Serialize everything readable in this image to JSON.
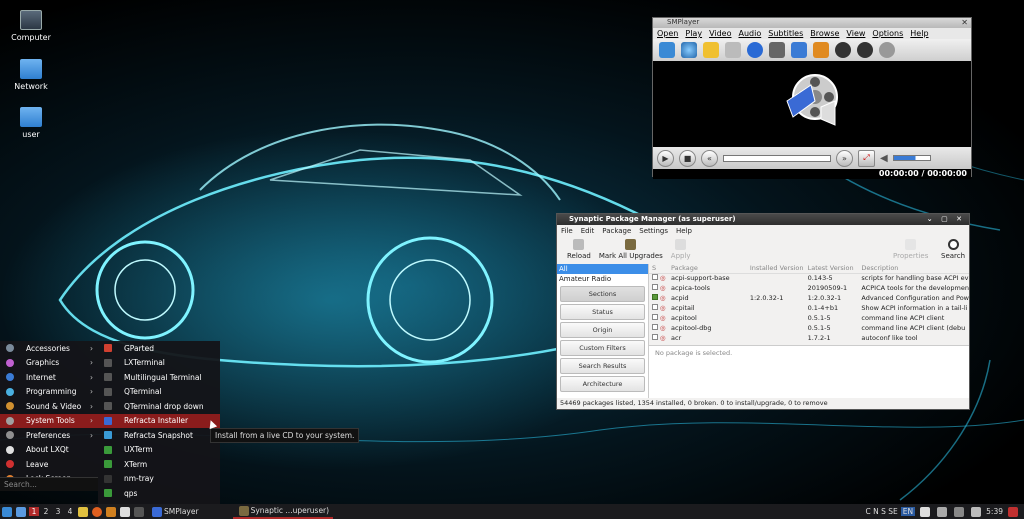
{
  "desktop_icons": [
    {
      "label": "Computer",
      "icon": "computer-icon"
    },
    {
      "label": "Network",
      "icon": "network-folder-icon"
    },
    {
      "label": "user",
      "icon": "home-folder-icon"
    }
  ],
  "smplayer": {
    "title": "SMPlayer",
    "menu": [
      "Open",
      "Play",
      "Video",
      "Audio",
      "Subtitles",
      "Browse",
      "View",
      "Options",
      "Help"
    ],
    "time": "00:00:00 / 00:00:00"
  },
  "synaptic": {
    "title": "Synaptic Package Manager  (as superuser)",
    "menu": [
      "File",
      "Edit",
      "Package",
      "Settings",
      "Help"
    ],
    "toolbar": {
      "reload": "Reload",
      "mark_all": "Mark All Upgrades",
      "apply": "Apply",
      "properties": "Properties",
      "search": "Search"
    },
    "filters": [
      "All",
      "Amateur Radio"
    ],
    "side_buttons": [
      "Sections",
      "Status",
      "Origin",
      "Custom Filters",
      "Search Results",
      "Architecture"
    ],
    "columns": [
      "S",
      "Package",
      "Installed Version",
      "Latest Version",
      "Description"
    ],
    "rows": [
      {
        "name": "acpi-support-base",
        "installed": "",
        "latest": "0.143-5",
        "desc": "scripts for handling base ACPI ev",
        "checked": false
      },
      {
        "name": "acpica-tools",
        "installed": "",
        "latest": "20190509-1",
        "desc": "ACPICA tools for the developmen",
        "checked": false
      },
      {
        "name": "acpid",
        "installed": "1:2.0.32-1",
        "latest": "1:2.0.32-1",
        "desc": "Advanced Configuration and Pow",
        "checked": true
      },
      {
        "name": "acpitail",
        "installed": "",
        "latest": "0.1-4+b1",
        "desc": "Show ACPI information in a tail-li",
        "checked": false
      },
      {
        "name": "acpitool",
        "installed": "",
        "latest": "0.5.1-5",
        "desc": "command line ACPI client",
        "checked": false
      },
      {
        "name": "acpitool-dbg",
        "installed": "",
        "latest": "0.5.1-5",
        "desc": "command line ACPI client (debu",
        "checked": false
      },
      {
        "name": "acr",
        "installed": "",
        "latest": "1.7.2-1",
        "desc": "autoconf like tool",
        "checked": false
      }
    ],
    "no_selection": "No package is selected.",
    "status": "54469 packages listed, 1354 installed, 0 broken. 0 to install/upgrade, 0 to remove"
  },
  "start_menu": {
    "items": [
      {
        "label": "Accessories",
        "color": "#7a8a9a",
        "sub": true
      },
      {
        "label": "Graphics",
        "color": "#c060d0",
        "sub": true
      },
      {
        "label": "Internet",
        "color": "#3a7bd5",
        "sub": true
      },
      {
        "label": "Programming",
        "color": "#4ab0e0",
        "sub": true
      },
      {
        "label": "Sound & Video",
        "color": "#d09030",
        "sub": true
      },
      {
        "label": "System Tools",
        "color": "#a0a0a0",
        "sub": true
      },
      {
        "label": "Preferences",
        "color": "#909090",
        "sub": true
      },
      {
        "label": "About LXQt",
        "color": "#e0e0e0",
        "sub": false
      },
      {
        "label": "Leave",
        "color": "#d03030",
        "sub": false
      },
      {
        "label": "Lock Screen",
        "color": "#e08030",
        "sub": false
      }
    ],
    "search_placeholder": "Search..."
  },
  "system_tools": [
    {
      "label": "GParted",
      "color": "#d04030"
    },
    {
      "label": "LXTerminal",
      "color": "#555"
    },
    {
      "label": "Multilingual Terminal",
      "color": "#555"
    },
    {
      "label": "QTerminal",
      "color": "#555"
    },
    {
      "label": "QTerminal drop down",
      "color": "#555"
    },
    {
      "label": "Refracta Installer",
      "color": "#3a6ad5"
    },
    {
      "label": "Refracta Snapshot",
      "color": "#3a9ad5"
    },
    {
      "label": "UXTerm",
      "color": "#3a9a3a"
    },
    {
      "label": "XTerm",
      "color": "#3a9a3a"
    },
    {
      "label": "nm-tray",
      "color": "#333"
    },
    {
      "label": "qps",
      "color": "#3a9a3a"
    }
  ],
  "tooltip": "Install from a live CD to your system.",
  "taskbar": {
    "workspaces": [
      "1",
      "2",
      "3",
      "4"
    ],
    "current_workspace": "1",
    "tasks": [
      {
        "label": "SMPlayer",
        "active": false
      },
      {
        "label": "Synaptic ...uperuser)",
        "active": true
      }
    ],
    "tray": {
      "kbd": "C N S SE",
      "lang": "EN",
      "time": "5:39"
    }
  }
}
